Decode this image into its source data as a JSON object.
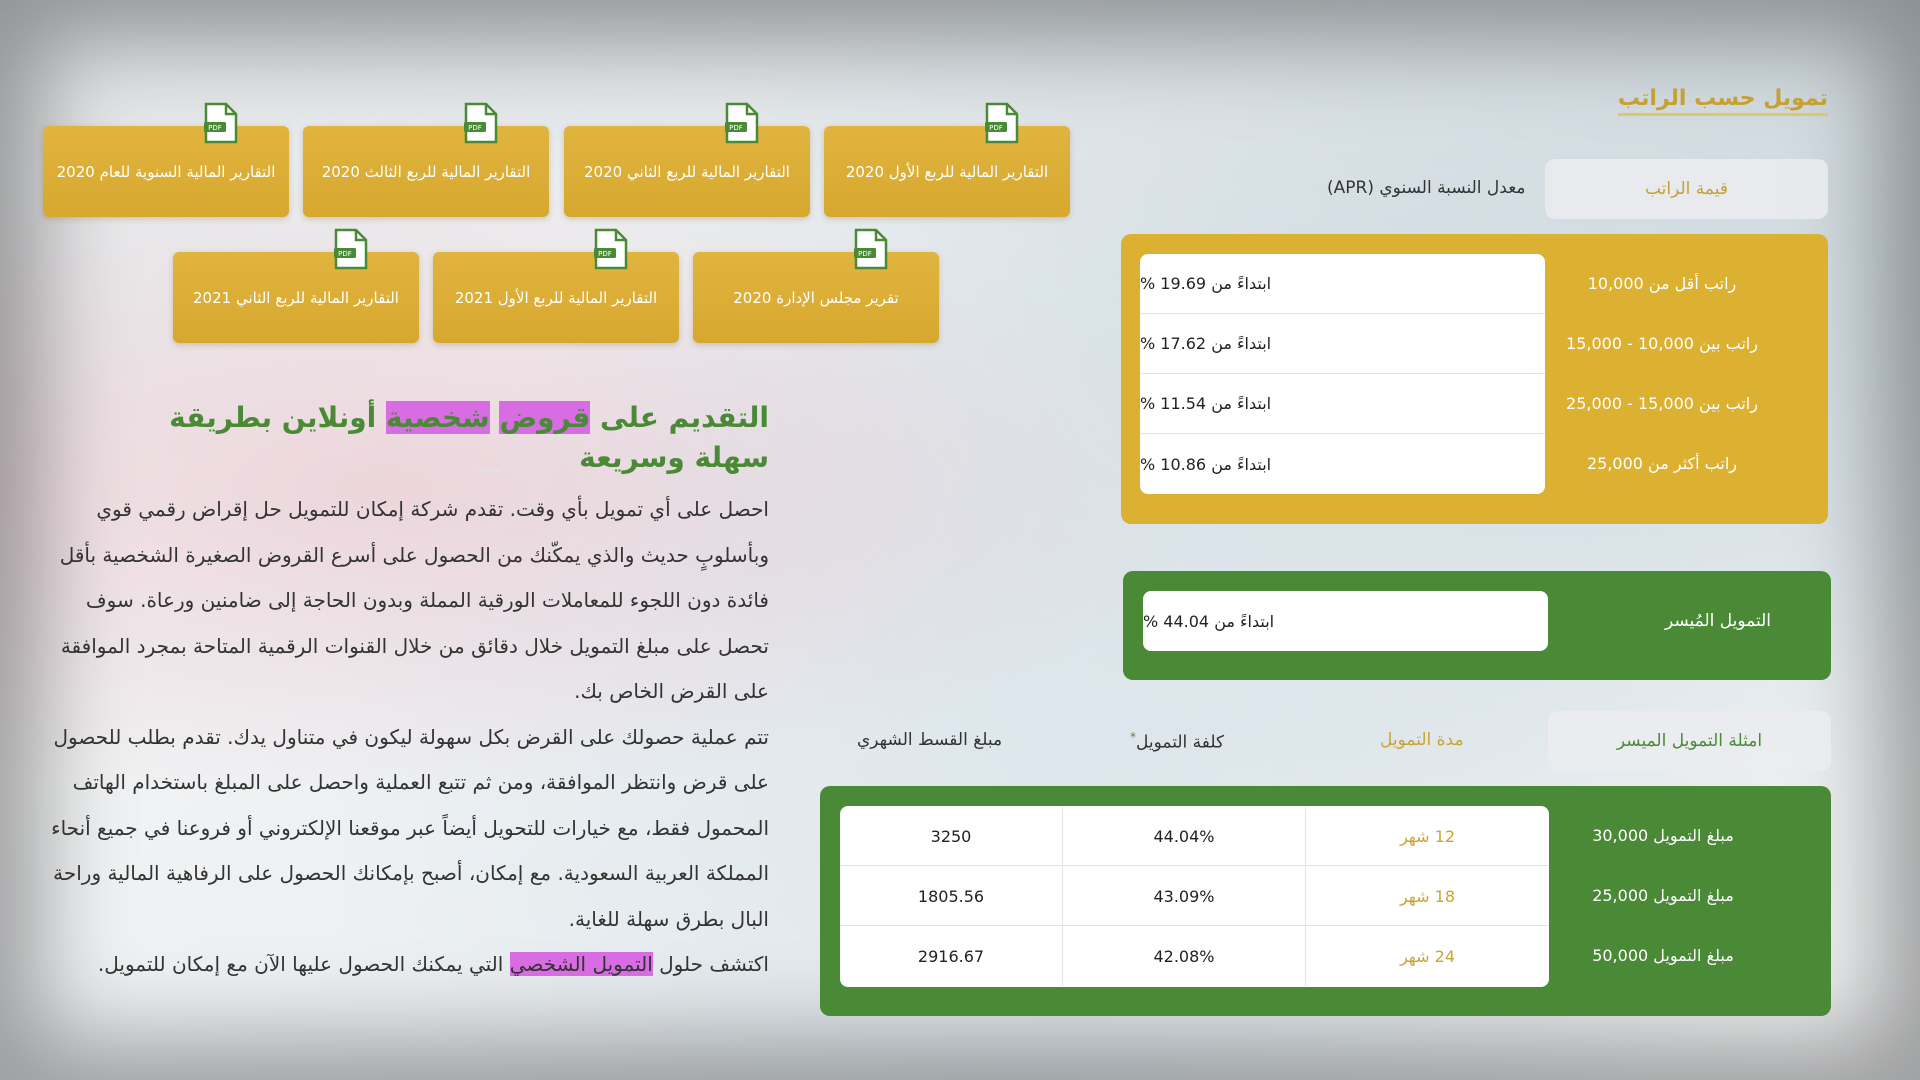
{
  "pdf_reports": {
    "row1": [
      {
        "label": "التقارير المالية للربع الأول 2020"
      },
      {
        "label": "التقارير المالية للربع الثاني 2020"
      },
      {
        "label": "التقارير المالية للربع الثالث 2020"
      },
      {
        "label": "التقارير المالية السنوية للعام 2020"
      }
    ],
    "row2": [
      {
        "label": "تقرير مجلس الإدارة 2020"
      },
      {
        "label": "التقارير المالية للربع الأول 2021"
      },
      {
        "label": "التقارير المالية للربع الثاني 2021"
      }
    ],
    "icon_text": "PDF"
  },
  "salary_financing": {
    "title": "تمويل حسب الراتب",
    "header_salary": "قيمة الراتب",
    "header_apr": "معدل النسبة السنوي (APR)",
    "rows": [
      {
        "salary": "راتب أقل من 10,000",
        "rate": "ابتداءً من 19.69 %"
      },
      {
        "salary": "راتب بين 10,000 - 15,000",
        "rate": "ابتداءً من 17.62 %"
      },
      {
        "salary": "راتب بين 15,000 - 25,000",
        "rate": "ابتداءً من 11.54 %"
      },
      {
        "salary": "راتب أكثر من 25,000",
        "rate": "ابتداءً من 10.86 %"
      }
    ]
  },
  "easy_financing": {
    "label": "التمويل المُيسر",
    "rate": "ابتداءً من 44.04 %"
  },
  "examples": {
    "header_examples": "امثلة التمويل الميسر",
    "header_duration": "مدة التمويل",
    "header_cost": "كلفة التمويل",
    "header_cost_mark": "*",
    "header_monthly": "مبلغ القسط الشهري",
    "rows": [
      {
        "amount": "مبلغ التمويل 30,000",
        "duration": "12 شهر",
        "cost": "44.04%",
        "monthly": "3250"
      },
      {
        "amount": "مبلغ التمويل 25,000",
        "duration": "18 شهر",
        "cost": "43.09%",
        "monthly": "1805.56"
      },
      {
        "amount": "مبلغ التمويل 50,000",
        "duration": "24 شهر",
        "cost": "42.08%",
        "monthly": "2916.67"
      }
    ]
  },
  "article": {
    "title_part1": "التقديم على ",
    "title_hl1": "قروض",
    "title_space": " ",
    "title_hl2": "شخصية",
    "title_part2": " أونلاين بطريقة سهلة وسريعة",
    "para1": "احصل على أي تمويل بأي وقت. تقدم شركة إمكان للتمويل حل إقراض رقمي قوي وبأسلوبٍ حديث والذي يمكّنك من الحصول على أسرع القروض الصغيرة الشخصية بأقل فائدة دون اللجوء للمعاملات الورقية المملة وبدون الحاجة إلى ضامنين ورعاة. سوف تحصل على مبلغ التمويل خلال دقائق من خلال القنوات الرقمية المتاحة بمجرد الموافقة على القرض الخاص بك.",
    "para2": "تتم عملية حصولك على القرض بكل سهولة ليكون في متناول يدك. تقدم بطلب للحصول على قرض وانتظر الموافقة، ومن ثم تتبع العملية واحصل على المبلغ باستخدام الهاتف المحمول فقط، مع خيارات للتحويل أيضاً عبر موقعنا الإلكتروني أو فروعنا في جميع أنحاء المملكة العربية السعودية. مع إمكان، أصبح بإمكانك الحصول على الرفاهية المالية وراحة البال بطرق سهلة للغاية.",
    "para3_a": "اكتشف حلول ",
    "para3_hl": "التمويل الشخصي",
    "para3_b": " التي يمكنك الحصول عليها الآن مع إمكان للتمويل."
  },
  "colors": {
    "gold": "#dcb031",
    "green": "#4a8a37",
    "highlight": "#d86de3",
    "gold_text": "#c6a033"
  }
}
